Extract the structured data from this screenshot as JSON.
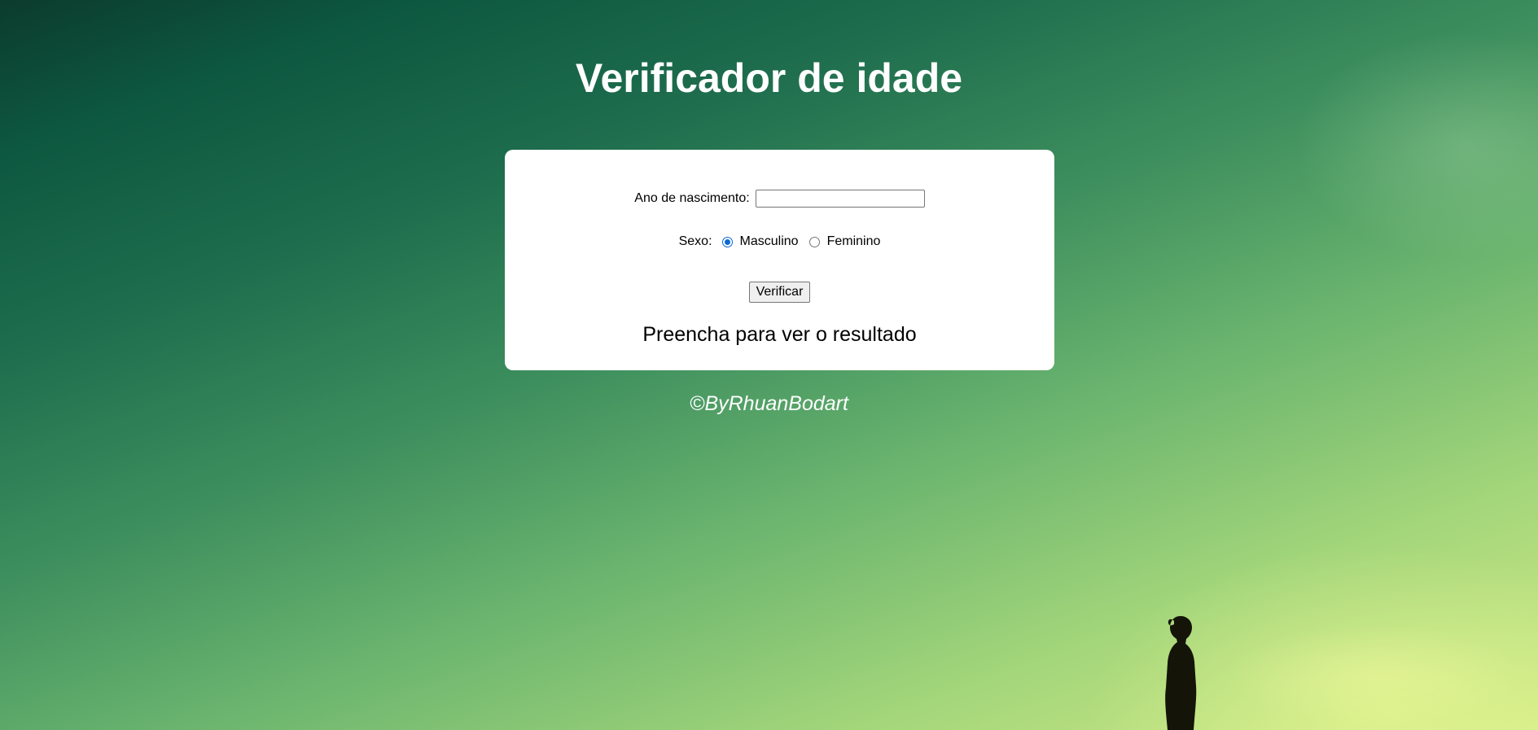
{
  "page": {
    "title": "Verificador de idade",
    "footer": "©ByRhuanBodart"
  },
  "form": {
    "year_label": "Ano de nascimento:",
    "year_value": "",
    "year_placeholder": "",
    "sex_label": "Sexo:",
    "options": [
      {
        "label": "Masculino",
        "checked": true
      },
      {
        "label": "Feminino",
        "checked": false
      }
    ],
    "verify_label": "Verificar",
    "result_text": "Preencha para ver o resultado"
  },
  "colors": {
    "title": "#ffffff",
    "card_background": "#ffffff",
    "radio_accent": "#0b68d4",
    "background_dark": "#0d5840",
    "background_light": "#d2ec88"
  },
  "background": {
    "image_description_icon": "silhouette-person-icon"
  }
}
